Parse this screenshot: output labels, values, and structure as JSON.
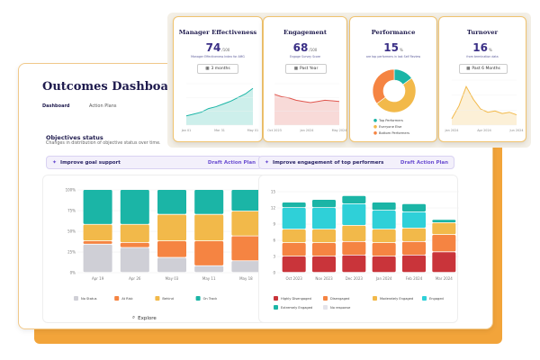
{
  "dashboard": {
    "title": "Outcomes Dashboard",
    "tabs": [
      {
        "label": "Dashboard",
        "active": true
      },
      {
        "label": "Action Plans",
        "active": false
      }
    ],
    "section_title": "Objectives status",
    "section_subtitle": "Changes in distribution of objective status over time.",
    "explore_label": "Explore"
  },
  "goals": [
    {
      "text": "Improve goal support",
      "link": "Draft Action Plan"
    },
    {
      "text": "Improve engagement of top performers",
      "link": "Draft Action Plan"
    }
  ],
  "cards": [
    {
      "title": "Manager Effectiveness",
      "value": "74",
      "unit": "/100",
      "subtitle": "Manager Effectiveness Index for AMG",
      "select": "3 months",
      "x_labels": [
        "Jan 01",
        "May 01"
      ],
      "x_mid": "Mar 31"
    },
    {
      "title": "Engagement",
      "value": "68",
      "unit": "/100",
      "subtitle": "Engage Survey Score",
      "select": "Past Year",
      "x_labels": [
        "Oct 2023",
        "Jan 2024",
        "May 2024"
      ]
    },
    {
      "title": "Performance",
      "value": "15",
      "unit": "%",
      "subtitle": "are top performers in last Self Review",
      "legend": [
        "Top Performers",
        "Everyone Else",
        "Bottom Performers"
      ]
    },
    {
      "title": "Turnover",
      "value": "16",
      "unit": "%",
      "subtitle": "from termination data",
      "select": "Past 6 Months",
      "x_labels": [
        "Jan 2024",
        "Apr 2024",
        "Jun 2024"
      ]
    }
  ],
  "colors": {
    "teal": "#1bb5a6",
    "gray": "#cfcfd6",
    "red": "#e04a3a",
    "orange": "#f58442",
    "yellow": "#f2b94a",
    "cyan": "#2fd0d8",
    "dark_red": "#c9343a",
    "purple": "#6b4ed1"
  },
  "chart_data": [
    {
      "type": "bar",
      "stacked": true,
      "categories": [
        "Apr 19",
        "Apr 26",
        "May 03",
        "May 11",
        "May 18"
      ],
      "ylim": [
        0,
        100
      ],
      "y_ticks": [
        "0%",
        "25%",
        "50%",
        "75%",
        "100%"
      ],
      "series": [
        {
          "name": "No Status",
          "color": "#cfcfd6",
          "values": [
            34,
            30,
            18,
            8,
            14
          ]
        },
        {
          "name": "At Risk",
          "color": "#f58442",
          "values": [
            4,
            6,
            20,
            30,
            30
          ]
        },
        {
          "name": "Behind",
          "color": "#f2b94a",
          "values": [
            20,
            22,
            32,
            32,
            30
          ]
        },
        {
          "name": "On Track",
          "color": "#1bb5a6",
          "values": [
            42,
            42,
            30,
            30,
            26
          ]
        }
      ]
    },
    {
      "type": "bar",
      "stacked": true,
      "categories": [
        "Oct 2023",
        "Nov 2023",
        "Dec 2023",
        "Jan 2024",
        "Feb 2024",
        "Mar 2024"
      ],
      "ylim": [
        0,
        15
      ],
      "y_ticks": [
        "0",
        "3",
        "6",
        "9",
        "12",
        "15"
      ],
      "series": [
        {
          "name": "Highly Disengaged",
          "color": "#c9343a",
          "values": [
            3,
            3,
            3.2,
            3,
            3.2,
            3.8
          ]
        },
        {
          "name": "Disengaged",
          "color": "#f58442",
          "values": [
            2.5,
            2.5,
            2.5,
            2.5,
            2.5,
            3.2
          ]
        },
        {
          "name": "Moderately Engaged",
          "color": "#f2b94a",
          "values": [
            2.5,
            2.5,
            3.0,
            2.5,
            2.5,
            2.2
          ]
        },
        {
          "name": "Engaged",
          "color": "#2fd0d8",
          "values": [
            4,
            4,
            4,
            3.5,
            3.0,
            0
          ]
        },
        {
          "name": "Extremely Engaged",
          "color": "#1bb5a6",
          "values": [
            1,
            1.5,
            1.5,
            1.5,
            1.5,
            0.6
          ]
        },
        {
          "name": "No response",
          "color": "#e3e3ea",
          "values": [
            0,
            0,
            0,
            0,
            0,
            0
          ]
        }
      ]
    },
    {
      "type": "area",
      "x": [
        "Jan 01",
        "Mar 31",
        "May 01"
      ],
      "values": [
        40,
        42,
        44,
        48,
        50,
        53,
        56,
        60,
        64,
        70
      ],
      "color": "#1bb5a6"
    },
    {
      "type": "area",
      "x": [
        "Oct 2023",
        "Jan 2024",
        "May 2024"
      ],
      "values": [
        72,
        68,
        66,
        62,
        60,
        58,
        60,
        62,
        61,
        60
      ],
      "color": "#e0574f"
    },
    {
      "type": "pie",
      "donut": true,
      "labels": [
        "Top Performers",
        "Everyone Else",
        "Bottom Performers"
      ],
      "values": [
        15,
        50,
        35
      ],
      "colors": [
        "#1bb5a6",
        "#f2b94a",
        "#f58442"
      ]
    },
    {
      "type": "area",
      "x": [
        "Jan 2024",
        "Apr 2024",
        "Jun 2024"
      ],
      "values": [
        30,
        50,
        80,
        60,
        45,
        40,
        42,
        38,
        40,
        36
      ],
      "color": "#f2b94a"
    }
  ]
}
